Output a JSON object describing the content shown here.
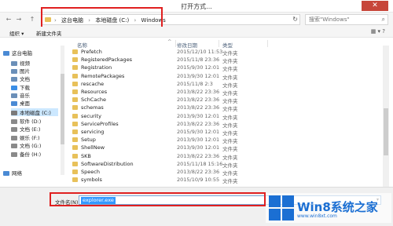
{
  "window": {
    "title": "打开方式...",
    "close_glyph": "✕"
  },
  "nav": {
    "back": "←",
    "forward": "→",
    "up": "↑"
  },
  "address": {
    "crumbs": [
      "这台电脑",
      "本地磁盘 (C:)",
      "Windows"
    ],
    "separator": "›",
    "refresh": "↻"
  },
  "search": {
    "placeholder": "搜索\"Windows\"",
    "icon": "search-icon"
  },
  "toolbar": {
    "organize": "组织 ▾",
    "new_folder": "新建文件夹",
    "icons": "▦ ▾  ?"
  },
  "columns": {
    "name": "名称",
    "date": "修改日期",
    "type": "类型",
    "sort_caret": "^"
  },
  "sidebar": {
    "items": [
      {
        "label": "这台电脑",
        "icon": "computer-icon",
        "color": "#4a8ad4"
      },
      {
        "label": "视频",
        "icon": "video-folder-icon",
        "color": "#6b8fb8"
      },
      {
        "label": "图片",
        "icon": "pictures-folder-icon",
        "color": "#6b8fb8"
      },
      {
        "label": "文档",
        "icon": "documents-folder-icon",
        "color": "#6b8fb8"
      },
      {
        "label": "下载",
        "icon": "downloads-folder-icon",
        "color": "#3a8ee6"
      },
      {
        "label": "音乐",
        "icon": "music-folder-icon",
        "color": "#6b8fb8"
      },
      {
        "label": "桌面",
        "icon": "desktop-folder-icon",
        "color": "#4a8ad4"
      },
      {
        "label": "本地磁盘 (C:)",
        "icon": "drive-icon",
        "color": "#7a7a7a",
        "selected": true
      },
      {
        "label": "软件 (D:)",
        "icon": "drive-icon",
        "color": "#8a8a8a"
      },
      {
        "label": "文档 (E:)",
        "icon": "drive-icon",
        "color": "#8a8a8a"
      },
      {
        "label": "娱乐 (F:)",
        "icon": "drive-icon",
        "color": "#8a8a8a"
      },
      {
        "label": "文档 (G:)",
        "icon": "drive-icon",
        "color": "#8a8a8a"
      },
      {
        "label": "备份 (H:)",
        "icon": "drive-icon",
        "color": "#8a8a8a"
      },
      {
        "label": "网络",
        "icon": "network-icon",
        "color": "#4a8ad4"
      }
    ]
  },
  "files": [
    {
      "name": "Prefetch",
      "date": "2015/12/10 11:53",
      "type": "文件夹"
    },
    {
      "name": "RegisteredPackages",
      "date": "2015/11/8 23:36",
      "type": "文件夹"
    },
    {
      "name": "Registration",
      "date": "2015/9/30 12:01",
      "type": "文件夹"
    },
    {
      "name": "RemotePackages",
      "date": "2013/9/30 12:01",
      "type": "文件夹"
    },
    {
      "name": "rescache",
      "date": "2015/11/8 2:3",
      "type": "文件夹"
    },
    {
      "name": "Resources",
      "date": "2013/8/22 23:36",
      "type": "文件夹"
    },
    {
      "name": "SchCache",
      "date": "2013/8/22 23:36",
      "type": "文件夹"
    },
    {
      "name": "schemas",
      "date": "2013/8/22 23:36",
      "type": "文件夹"
    },
    {
      "name": "security",
      "date": "2013/9/30 12:01",
      "type": "文件夹"
    },
    {
      "name": "ServiceProfiles",
      "date": "2013/8/22 23:36",
      "type": "文件夹"
    },
    {
      "name": "servicing",
      "date": "2015/9/30 12:01",
      "type": "文件夹"
    },
    {
      "name": "Setup",
      "date": "2013/9/30 12:01",
      "type": "文件夹"
    },
    {
      "name": "ShellNew",
      "date": "2013/9/30 12:01",
      "type": "文件夹"
    },
    {
      "name": "SKB",
      "date": "2013/8/22 23:36",
      "type": "文件夹"
    },
    {
      "name": "SoftwareDistribution",
      "date": "2015/11/18 15:16",
      "type": "文件夹"
    },
    {
      "name": "Speech",
      "date": "2013/8/22 23:36",
      "type": "文件夹"
    },
    {
      "name": "symbols",
      "date": "2015/10/9 10:55",
      "type": "文件夹"
    }
  ],
  "filename": {
    "label": "文件名(N):",
    "value": "explorer.exe",
    "dropdown": "▾"
  },
  "watermark": {
    "text": "Win8系统之家",
    "sub": "www.win8xt.com"
  },
  "colors": {
    "highlight_box": "#e02020",
    "accent": "#1b6fd3",
    "folder": "#e8c15a"
  }
}
